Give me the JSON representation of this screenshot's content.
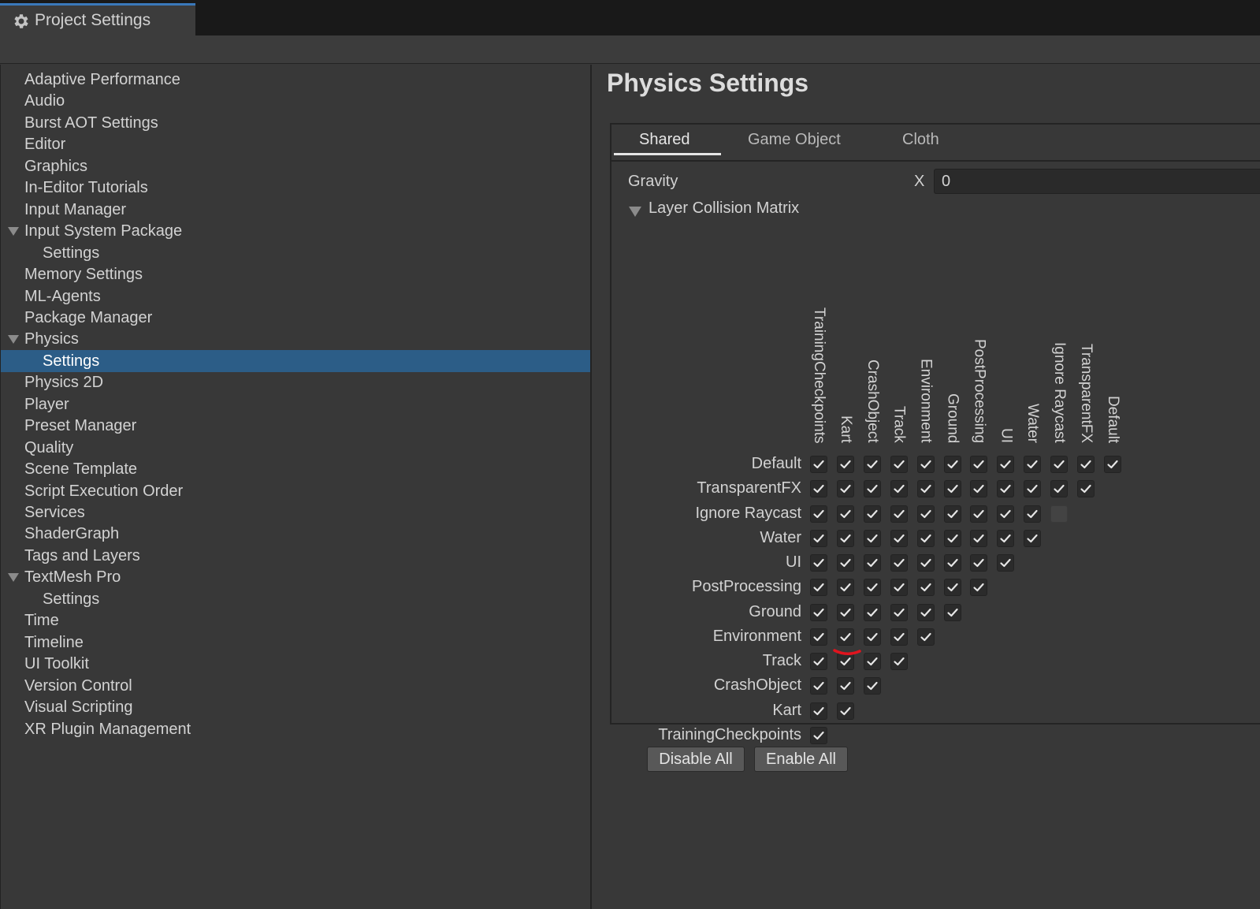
{
  "window": {
    "tab_title": "Project Settings",
    "tab_icon": "gear-icon"
  },
  "sidebar": {
    "items": [
      {
        "label": "Adaptive Performance",
        "depth": 0
      },
      {
        "label": "Audio",
        "depth": 0
      },
      {
        "label": "Burst AOT Settings",
        "depth": 0
      },
      {
        "label": "Editor",
        "depth": 0
      },
      {
        "label": "Graphics",
        "depth": 0
      },
      {
        "label": "In-Editor Tutorials",
        "depth": 0
      },
      {
        "label": "Input Manager",
        "depth": 0
      },
      {
        "label": "Input System Package",
        "depth": 0,
        "expanded": true
      },
      {
        "label": "Settings",
        "depth": 1
      },
      {
        "label": "Memory Settings",
        "depth": 0
      },
      {
        "label": "ML-Agents",
        "depth": 0
      },
      {
        "label": "Package Manager",
        "depth": 0
      },
      {
        "label": "Physics",
        "depth": 0,
        "expanded": true
      },
      {
        "label": "Settings",
        "depth": 1,
        "selected": true
      },
      {
        "label": "Physics 2D",
        "depth": 0
      },
      {
        "label": "Player",
        "depth": 0
      },
      {
        "label": "Preset Manager",
        "depth": 0
      },
      {
        "label": "Quality",
        "depth": 0
      },
      {
        "label": "Scene Template",
        "depth": 0
      },
      {
        "label": "Script Execution Order",
        "depth": 0
      },
      {
        "label": "Services",
        "depth": 0
      },
      {
        "label": "ShaderGraph",
        "depth": 0
      },
      {
        "label": "Tags and Layers",
        "depth": 0
      },
      {
        "label": "TextMesh Pro",
        "depth": 0,
        "expanded": true
      },
      {
        "label": "Settings",
        "depth": 1
      },
      {
        "label": "Time",
        "depth": 0
      },
      {
        "label": "Timeline",
        "depth": 0
      },
      {
        "label": "UI Toolkit",
        "depth": 0
      },
      {
        "label": "Version Control",
        "depth": 0
      },
      {
        "label": "Visual Scripting",
        "depth": 0
      },
      {
        "label": "XR Plugin Management",
        "depth": 0
      }
    ]
  },
  "main": {
    "title": "Physics Settings",
    "tabs": [
      {
        "label": "Shared",
        "active": true
      },
      {
        "label": "Game Object",
        "active": false
      },
      {
        "label": "Cloth",
        "active": false
      }
    ],
    "gravity": {
      "label": "Gravity",
      "axis_label": "X",
      "x_value": "0"
    },
    "matrix": {
      "title": "Layer Collision Matrix",
      "columns": [
        "TrainingCheckpoints",
        "Kart",
        "CrashObject",
        "Track",
        "Environment",
        "Ground",
        "PostProcessing",
        "UI",
        "Water",
        "Ignore Raycast",
        "TransparentFX",
        "Default"
      ],
      "rows": [
        "Default",
        "TransparentFX",
        "Ignore Raycast",
        "Water",
        "UI",
        "PostProcessing",
        "Ground",
        "Environment",
        "Track",
        "CrashObject",
        "Kart",
        "TrainingCheckpoints"
      ],
      "checked": [
        [
          1,
          1,
          1,
          1,
          1,
          1,
          1,
          1,
          1,
          1,
          1,
          1
        ],
        [
          1,
          1,
          1,
          1,
          1,
          1,
          1,
          1,
          1,
          1,
          1
        ],
        [
          1,
          1,
          1,
          1,
          1,
          1,
          1,
          1,
          1,
          0
        ],
        [
          1,
          1,
          1,
          1,
          1,
          1,
          1,
          1,
          1
        ],
        [
          1,
          1,
          1,
          1,
          1,
          1,
          1,
          1
        ],
        [
          1,
          1,
          1,
          1,
          1,
          1,
          1
        ],
        [
          1,
          1,
          1,
          1,
          1,
          1
        ],
        [
          1,
          1,
          1,
          1,
          1
        ],
        [
          1,
          1,
          1,
          1
        ],
        [
          1,
          1,
          1
        ],
        [
          1,
          1
        ],
        [
          1
        ]
      ]
    },
    "buttons": {
      "disable_all": "Disable All",
      "enable_all": "Enable All"
    }
  },
  "colors": {
    "selection": "#2c5d87",
    "tab_accent": "#3a79bb",
    "annotation": "#e0141e"
  }
}
